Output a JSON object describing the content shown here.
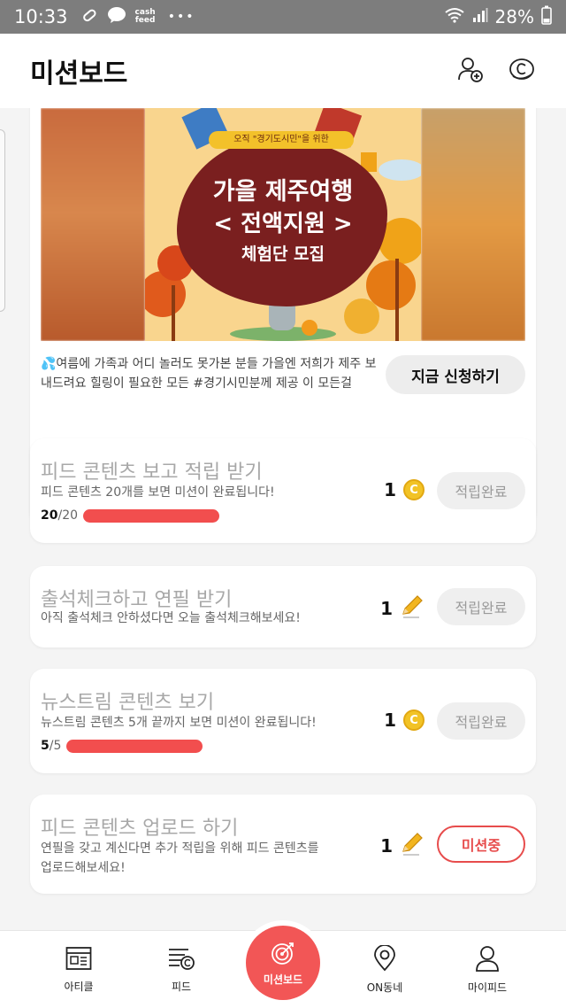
{
  "statusbar": {
    "time": "10:33",
    "cashfeed_top": "cash",
    "cashfeed_bottom": "feed",
    "dots": "•••",
    "battery": "28%"
  },
  "header": {
    "title": "미션보드",
    "icons": [
      "add-friend-icon",
      "coin-icon"
    ]
  },
  "banner": {
    "ribbon": "오직 \"경기도시민\"을 위한",
    "title_1": "가을 제주여행",
    "title_2": "< 전액지원 >",
    "title_3": "체험단 모집",
    "description": "💦여름에 가족과 어디 놀러도 못가본 분들 가을엔 저희가 제주 보내드려요  힐링이 필요한 모든 #경기시민분께 제공 이 모든걸",
    "apply_label": "지금 신청하기"
  },
  "missions": [
    {
      "title": "피드 콘텐츠 보고 적립 받기",
      "desc": "피드 콘텐츠 20개를 보면 미션이 완료됩니다!",
      "progress_current": "20",
      "progress_total": "/20",
      "progress_fraction": 1.0,
      "reward": "1",
      "reward_icon": "coin-icon",
      "coin_letter": "C",
      "status": "적립완료"
    },
    {
      "title": "출석체크하고 연필 받기",
      "desc": "아직 출석체크 안하셨다면 오늘 출석체크해보세요!",
      "reward": "1",
      "reward_icon": "pencil-icon",
      "status": "적립완료"
    },
    {
      "title": "뉴스트림 콘텐츠 보기",
      "desc": "뉴스트림 콘텐츠 5개 끝까지 보면 미션이 완료됩니다!",
      "progress_current": "5",
      "progress_total": "/5",
      "progress_fraction": 1.0,
      "reward": "1",
      "reward_icon": "coin-icon",
      "coin_letter": "C",
      "status": "적립완료"
    },
    {
      "title": "피드 콘텐츠 업로드 하기",
      "desc_line1": "연필을 갖고 계신다면 추가 적립을 위해 피드 콘텐츠를",
      "desc_line2": "업로드해보세요!",
      "reward": "1",
      "reward_icon": "pencil-icon",
      "status": "미션중"
    }
  ],
  "bottom_nav": [
    {
      "label": "아티클",
      "icon": "article-icon"
    },
    {
      "label": "피드",
      "icon": "feed-icon"
    },
    {
      "label": "미션보드",
      "icon": "target-icon",
      "active": true
    },
    {
      "label": "ON동네",
      "icon": "location-pin-icon"
    },
    {
      "label": "마이피드",
      "icon": "person-icon"
    }
  ],
  "colors": {
    "accent": "#f25656",
    "progress": "#f24e4e",
    "coin": "#f2c326",
    "banner_dark": "#7a1f1f"
  }
}
